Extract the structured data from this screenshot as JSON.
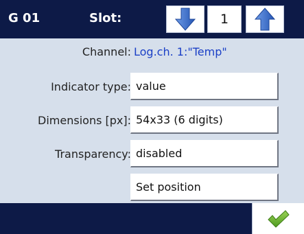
{
  "header": {
    "group_title": "G 01",
    "slot_label": "Slot:",
    "slot_value": "1",
    "down_icon": "arrow-down-icon",
    "up_icon": "arrow-up-icon"
  },
  "settings": {
    "channel_label": "Channel:",
    "channel_value": "Log.ch. 1:\"Temp\"",
    "indicator_type_label": "Indicator type:",
    "indicator_type_value": "value",
    "dimensions_label": "Dimensions [px]:",
    "dimensions_value": "54x33 (6 digits)",
    "transparency_label": "Transparency:",
    "transparency_value": "disabled",
    "set_position_label": "Set position"
  },
  "footer": {
    "confirm_icon": "checkmark-icon"
  },
  "colors": {
    "bar": "#0d1a47",
    "background": "#d6dfeb",
    "accent_arrow": "#3b6fd1",
    "channel_text": "#1a3fc6",
    "check": "#6ab02f"
  }
}
